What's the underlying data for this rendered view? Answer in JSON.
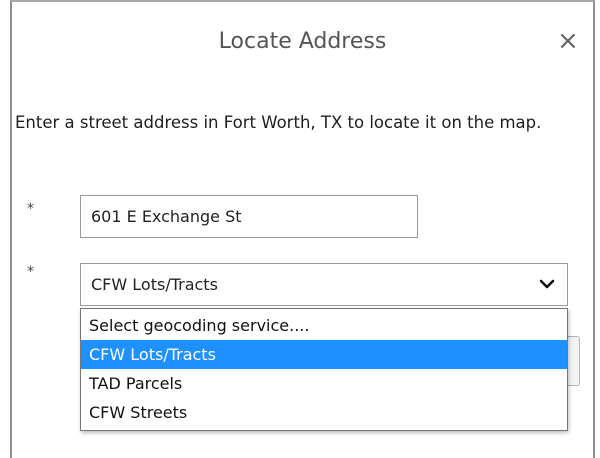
{
  "dialog": {
    "title": "Locate Address",
    "close_symbol": "×",
    "instructions": "Enter a street address in Fort Worth, TX to locate it on the map."
  },
  "form": {
    "required_marker": "*",
    "address_value": "601 E Exchange St",
    "service_selected": "CFW Lots/Tracts",
    "service_options": [
      "Select geocoding service....",
      "CFW Lots/Tracts",
      "TAD Parcels",
      "CFW Streets"
    ],
    "highlighted_index": 1
  },
  "icons": {
    "close": "close-icon",
    "dropdown": "chevron-down-icon"
  },
  "colors": {
    "highlight": "#1e90ff",
    "title_text": "#555555",
    "border": "#9a9a9a"
  }
}
